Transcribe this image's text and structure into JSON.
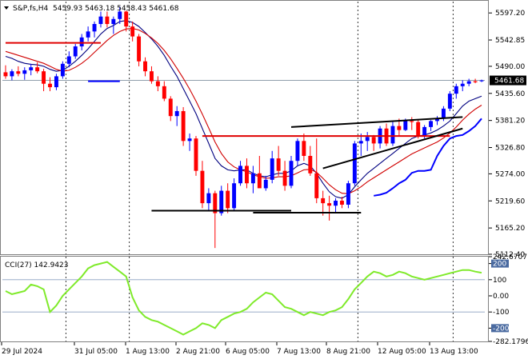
{
  "header": {
    "symbol_label": "S&P,fs,H4",
    "ohlc": "5459.93 5463.18 5458.43 5461.68"
  },
  "chart_data": [
    {
      "type": "candlestick",
      "symbol": "S&P,fs,H4",
      "current_price": 5461.68,
      "ylim": [
        5112.4,
        5620
      ],
      "price_ticks": [
        "5597.20",
        "5542.85",
        "5490.00",
        "5435.60",
        "5381.20",
        "5326.80",
        "5274.00",
        "5219.60",
        "5165.20",
        "5112.40"
      ],
      "time_labels": [
        "29 Jul 2024",
        "31 Jul 05:00",
        "1 Aug 13:00",
        "2 Aug 21:00",
        "6 Aug 05:00",
        "7 Aug 13:00",
        "8 Aug 21:00",
        "12 Aug 05:00",
        "13 Aug 13:00"
      ],
      "candles": [
        [
          5478,
          5492,
          5465,
          5470
        ],
        [
          5470,
          5484,
          5462,
          5480
        ],
        [
          5480,
          5490,
          5470,
          5475
        ],
        [
          5475,
          5488,
          5463,
          5482
        ],
        [
          5482,
          5495,
          5472,
          5488
        ],
        [
          5488,
          5498,
          5476,
          5480
        ],
        [
          5480,
          5485,
          5440,
          5455
        ],
        [
          5455,
          5468,
          5440,
          5448
        ],
        [
          5448,
          5475,
          5442,
          5470
        ],
        [
          5470,
          5500,
          5465,
          5495
        ],
        [
          5495,
          5520,
          5488,
          5510
        ],
        [
          5510,
          5535,
          5505,
          5530
        ],
        [
          5530,
          5555,
          5522,
          5548
        ],
        [
          5548,
          5570,
          5540,
          5560
        ],
        [
          5560,
          5580,
          5548,
          5575
        ],
        [
          5575,
          5600,
          5568,
          5590
        ],
        [
          5590,
          5600,
          5568,
          5575
        ],
        [
          5575,
          5590,
          5555,
          5585
        ],
        [
          5585,
          5610,
          5575,
          5600
        ],
        [
          5600,
          5602,
          5560,
          5570
        ],
        [
          5570,
          5580,
          5540,
          5550
        ],
        [
          5550,
          5555,
          5490,
          5500
        ],
        [
          5500,
          5508,
          5470,
          5480
        ],
        [
          5480,
          5490,
          5455,
          5460
        ],
        [
          5460,
          5470,
          5440,
          5450
        ],
        [
          5450,
          5460,
          5420,
          5425
        ],
        [
          5425,
          5430,
          5380,
          5390
        ],
        [
          5390,
          5410,
          5370,
          5400
        ],
        [
          5400,
          5408,
          5330,
          5340
        ],
        [
          5340,
          5355,
          5320,
          5345
        ],
        [
          5345,
          5350,
          5270,
          5280
        ],
        [
          5280,
          5300,
          5205,
          5215
        ],
        [
          5215,
          5245,
          5200,
          5235
        ],
        [
          5235,
          5240,
          5125,
          5195
        ],
        [
          5195,
          5250,
          5190,
          5240
        ],
        [
          5240,
          5255,
          5195,
          5205
        ],
        [
          5205,
          5265,
          5200,
          5255
        ],
        [
          5255,
          5300,
          5250,
          5290
        ],
        [
          5290,
          5305,
          5245,
          5255
        ],
        [
          5255,
          5290,
          5235,
          5275
        ],
        [
          5275,
          5310,
          5255,
          5245
        ],
        [
          5245,
          5270,
          5240,
          5262
        ],
        [
          5262,
          5320,
          5255,
          5305
        ],
        [
          5305,
          5330,
          5270,
          5280
        ],
        [
          5280,
          5300,
          5240,
          5250
        ],
        [
          5250,
          5310,
          5245,
          5300
        ],
        [
          5300,
          5345,
          5290,
          5340
        ],
        [
          5340,
          5355,
          5300,
          5310
        ],
        [
          5310,
          5330,
          5270,
          5275
        ],
        [
          5275,
          5345,
          5215,
          5225
        ],
        [
          5225,
          5240,
          5190,
          5215
        ],
        [
          5215,
          5230,
          5180,
          5210
        ],
        [
          5210,
          5225,
          5195,
          5220
        ],
        [
          5220,
          5228,
          5205,
          5212
        ],
        [
          5212,
          5260,
          5205,
          5255
        ],
        [
          5255,
          5340,
          5250,
          5335
        ],
        [
          5335,
          5355,
          5310,
          5340
        ],
        [
          5340,
          5358,
          5320,
          5348
        ],
        [
          5348,
          5352,
          5320,
          5335
        ],
        [
          5335,
          5370,
          5325,
          5365
        ],
        [
          5365,
          5375,
          5330,
          5335
        ],
        [
          5335,
          5380,
          5330,
          5370
        ],
        [
          5370,
          5385,
          5350,
          5362
        ],
        [
          5362,
          5385,
          5360,
          5380
        ],
        [
          5380,
          5388,
          5362,
          5378
        ],
        [
          5378,
          5382,
          5345,
          5350
        ],
        [
          5350,
          5372,
          5345,
          5368
        ],
        [
          5368,
          5382,
          5360,
          5380
        ],
        [
          5380,
          5390,
          5372,
          5385
        ],
        [
          5385,
          5410,
          5380,
          5405
        ],
        [
          5405,
          5440,
          5400,
          5435
        ],
        [
          5435,
          5455,
          5425,
          5450
        ],
        [
          5450,
          5462,
          5440,
          5455
        ],
        [
          5455,
          5465,
          5450,
          5460
        ],
        [
          5460,
          5465,
          5456,
          5458
        ],
        [
          5459.93,
          5463.18,
          5458.43,
          5461.68
        ]
      ],
      "moving_averages": [
        {
          "color": "#000080",
          "values": [
            5510,
            5506,
            5500,
            5496,
            5494,
            5493,
            5490,
            5484,
            5480,
            5482,
            5490,
            5500,
            5512,
            5525,
            5540,
            5555,
            5566,
            5572,
            5580,
            5582,
            5578,
            5570,
            5558,
            5545,
            5530,
            5512,
            5490,
            5470,
            5445,
            5420,
            5395,
            5365,
            5335,
            5305,
            5290,
            5282,
            5280,
            5282,
            5282,
            5275,
            5270,
            5268,
            5272,
            5275,
            5275,
            5280,
            5290,
            5295,
            5290,
            5275,
            5255,
            5238,
            5228,
            5225,
            5232,
            5248,
            5262,
            5275,
            5285,
            5295,
            5305,
            5315,
            5325,
            5335,
            5345,
            5350,
            5352,
            5356,
            5362,
            5370,
            5380,
            5395,
            5410,
            5420,
            5425,
            5430
          ]
        },
        {
          "color": "#d00000",
          "values": [
            5520,
            5516,
            5512,
            5508,
            5504,
            5500,
            5496,
            5490,
            5484,
            5480,
            5482,
            5488,
            5496,
            5506,
            5518,
            5530,
            5542,
            5552,
            5560,
            5565,
            5566,
            5563,
            5556,
            5547,
            5536,
            5522,
            5505,
            5486,
            5466,
            5444,
            5420,
            5394,
            5366,
            5338,
            5315,
            5298,
            5288,
            5282,
            5278,
            5272,
            5268,
            5265,
            5266,
            5268,
            5268,
            5270,
            5276,
            5282,
            5283,
            5277,
            5265,
            5252,
            5242,
            5235,
            5234,
            5240,
            5248,
            5258,
            5266,
            5274,
            5282,
            5290,
            5298,
            5306,
            5314,
            5320,
            5326,
            5332,
            5338,
            5346,
            5356,
            5368,
            5382,
            5394,
            5404,
            5412
          ]
        },
        {
          "color": "#0000ff",
          "values": [
            null,
            null,
            null,
            null,
            null,
            null,
            null,
            null,
            null,
            null,
            null,
            null,
            null,
            5460,
            5460,
            5460,
            5460,
            5460,
            5460,
            null,
            null,
            null,
            null,
            null,
            null,
            null,
            null,
            null,
            null,
            null,
            null,
            null,
            null,
            null,
            null,
            null,
            null,
            null,
            null,
            null,
            null,
            null,
            null,
            null,
            null,
            null,
            null,
            null,
            null,
            null,
            null,
            null,
            null,
            null,
            null,
            null,
            null,
            null,
            5230,
            5232,
            5236,
            5245,
            5255,
            5262,
            5276,
            5280,
            5280,
            5282,
            5310,
            5330,
            5345,
            5350,
            5352,
            5360,
            5370,
            5385
          ]
        }
      ],
      "annotations": [
        {
          "kind": "horizontal-line",
          "color": "#e00000",
          "price": 5537,
          "from_candle": 0,
          "to_candle": 15
        },
        {
          "kind": "horizontal-line",
          "color": "#e00000",
          "price": 5350,
          "from_candle": 31,
          "to_candle": 70
        },
        {
          "kind": "horizontal-line",
          "color": "#000000",
          "price": 5200,
          "from_candle": 23,
          "to_candle": 45
        },
        {
          "kind": "horizontal-line",
          "color": "#000000",
          "price": 5196,
          "from_candle": 39,
          "to_candle": 56
        },
        {
          "kind": "trendline",
          "color": "#000000",
          "points": [
            [
              45,
              5368
            ],
            [
              72,
              5388
            ]
          ]
        },
        {
          "kind": "trendline",
          "color": "#000000",
          "points": [
            [
              50,
              5285
            ],
            [
              72,
              5365
            ]
          ]
        },
        {
          "kind": "current-price-line",
          "color": "#8090a0",
          "price": 5461.68
        }
      ]
    },
    {
      "type": "line",
      "indicator": "CCI(27)",
      "current_value": 142.9423,
      "label": "CCI(27) 142.9423",
      "ylim": [
        -282.1796,
        242.6707
      ],
      "axis_labels": [
        "242.6707",
        "200",
        "100",
        "0.00",
        "-100",
        "-200",
        "-282.1796"
      ],
      "level_lines": [
        100,
        -100
      ],
      "series": [
        {
          "color": "#7fea2a",
          "values": [
            30,
            10,
            20,
            30,
            70,
            60,
            40,
            -100,
            -60,
            0,
            40,
            80,
            120,
            170,
            190,
            200,
            210,
            180,
            150,
            120,
            -10,
            -90,
            -130,
            -150,
            -160,
            -180,
            -200,
            -220,
            -240,
            -220,
            -200,
            -170,
            -180,
            -200,
            -150,
            -130,
            -110,
            -100,
            -80,
            -40,
            -10,
            20,
            10,
            -30,
            -70,
            -80,
            -100,
            -120,
            -100,
            -110,
            -120,
            -100,
            -90,
            -70,
            -20,
            40,
            80,
            120,
            150,
            140,
            120,
            130,
            150,
            140,
            120,
            110,
            100,
            110,
            120,
            130,
            140,
            150,
            160,
            160,
            150,
            142.9423
          ]
        }
      ]
    }
  ]
}
